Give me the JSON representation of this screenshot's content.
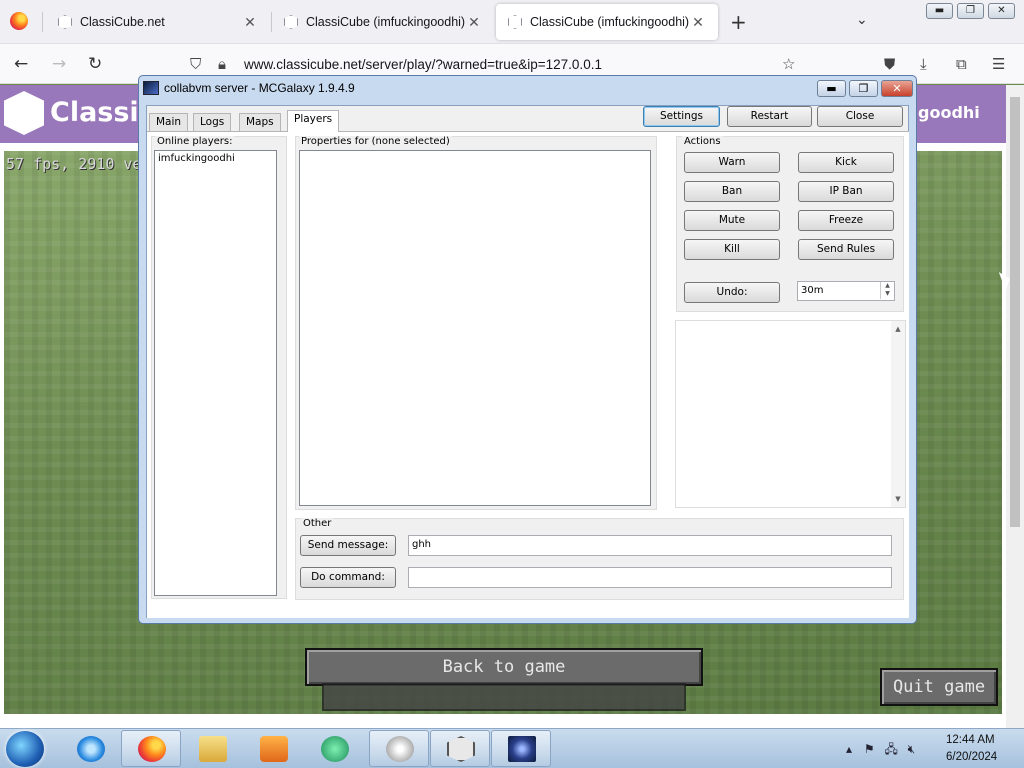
{
  "browser": {
    "tabs": [
      {
        "title": "ClassiCube.net"
      },
      {
        "title": "ClassiCube (imfuckingoodhi)"
      },
      {
        "title": "ClassiCube (imfuckingoodhi)"
      }
    ],
    "close_glyph": "✕",
    "new_tab_glyph": "+",
    "list_tabs_glyph": "⌄",
    "url": "www.classicube.net/server/play/?warned=true&ip=127.0.0.1",
    "win_minimize": "▬",
    "win_restore": "❐",
    "win_close": "✕"
  },
  "page": {
    "logo_text": "ClassiC",
    "username": "goodhi",
    "fps_text": "57 fps, 2910 ve",
    "back_to_game": "Back to game",
    "quit_game": "Quit game"
  },
  "dialog": {
    "title": "collabvm server - MCGalaxy 1.9.4.9",
    "tabs": [
      "Main",
      "Logs",
      "Maps",
      "Players"
    ],
    "active_tab": "Players",
    "top_buttons": {
      "settings": "Settings",
      "restart": "Restart",
      "close": "Close"
    },
    "online_players_label": "Online players:",
    "online_players": [
      "imfuckingoodhi"
    ],
    "properties_label": "Properties for (none selected)",
    "actions_label": "Actions",
    "actions": {
      "warn": "Warn",
      "kick": "Kick",
      "ban": "Ban",
      "ip_ban": "IP Ban",
      "mute": "Mute",
      "freeze": "Freeze",
      "kill": "Kill",
      "send_rules": "Send Rules",
      "undo": "Undo:"
    },
    "undo_value": "30m",
    "other_label": "Other",
    "send_message_label": "Send message:",
    "send_message_value": "ghh",
    "do_command_label": "Do command:",
    "do_command_value": ""
  },
  "taskbar": {
    "time": "12:44 AM",
    "date": "6/20/2024"
  }
}
